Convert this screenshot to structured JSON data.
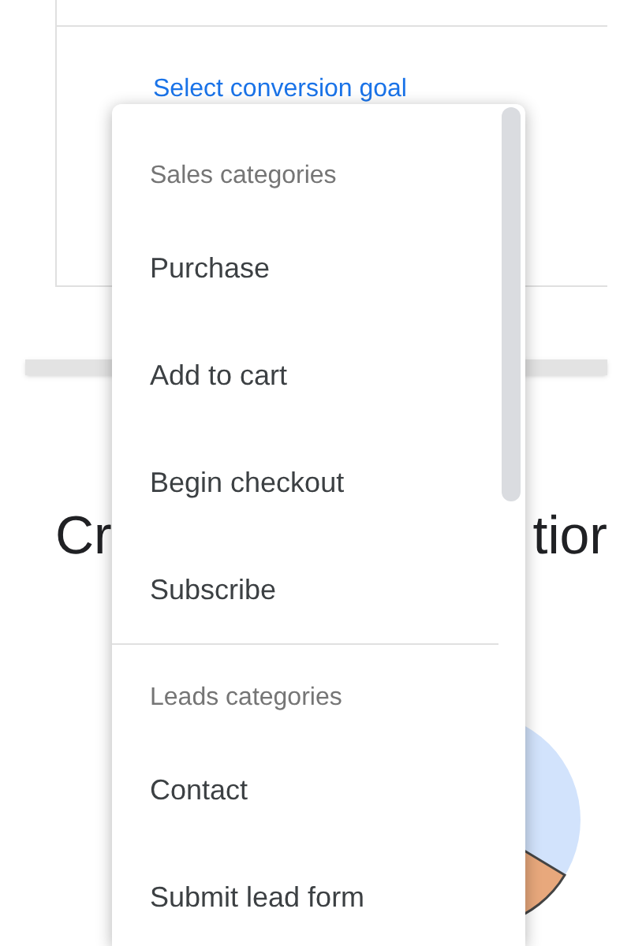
{
  "card": {
    "link": "Select conversion goal"
  },
  "heading": {
    "left_part": "Cr",
    "right_part": "tior"
  },
  "menu": {
    "groups": [
      {
        "header": "Sales categories",
        "items": [
          {
            "label": "Purchase"
          },
          {
            "label": "Add to cart"
          },
          {
            "label": "Begin checkout"
          },
          {
            "label": "Subscribe"
          }
        ]
      },
      {
        "header": "Leads categories",
        "items": [
          {
            "label": "Contact"
          },
          {
            "label": "Submit lead form"
          }
        ]
      }
    ]
  }
}
